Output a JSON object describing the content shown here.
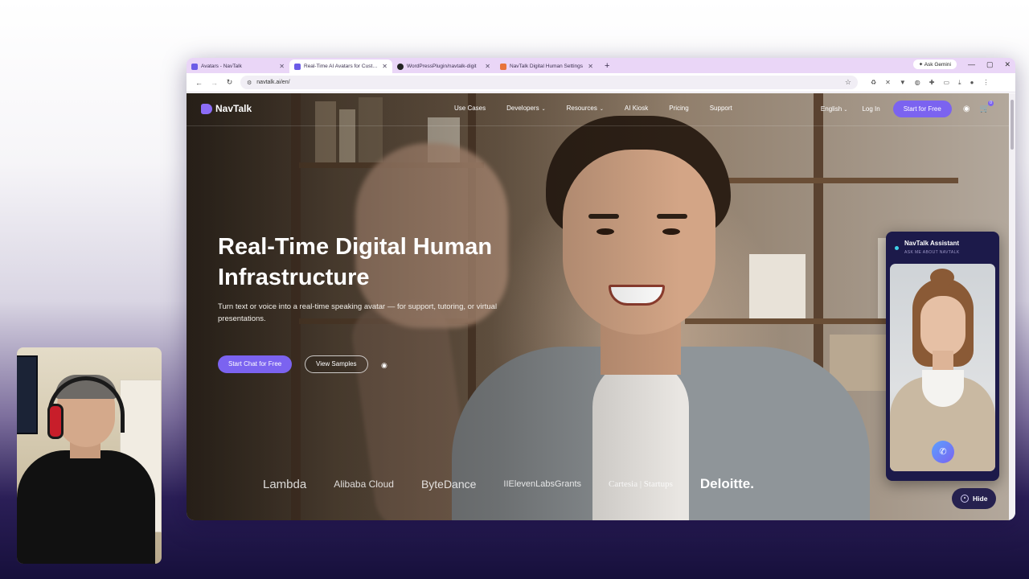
{
  "browser": {
    "tabs": [
      {
        "label": "Avatars - NavTalk",
        "favicon_color": "#6c5ce7",
        "active": false
      },
      {
        "label": "Real-Time AI Avatars for Custom",
        "favicon_color": "#6c5ce7",
        "active": true
      },
      {
        "label": "WordPressPlugin/navtalk-digit",
        "favicon_color": "#222222",
        "active": false
      },
      {
        "label": "NavTalk Digital Human Settings",
        "favicon_color": "#e8743b",
        "active": false
      }
    ],
    "new_tab": "+",
    "gemini_label": "Ask Gemini",
    "url": "navtalk.ai/en/"
  },
  "site": {
    "logo": "NavTalk",
    "menu": [
      {
        "label": "Use Cases",
        "has_caret": false
      },
      {
        "label": "Developers",
        "has_caret": true
      },
      {
        "label": "Resources",
        "has_caret": true
      },
      {
        "label": "AI Kiosk",
        "has_caret": false
      },
      {
        "label": "Pricing",
        "has_caret": false
      },
      {
        "label": "Support",
        "has_caret": false
      }
    ],
    "language": "English",
    "login": "Log In",
    "cta": "Start for Free",
    "cart_count": "0"
  },
  "hero": {
    "title": "Real-Time Digital Human Infrastructure",
    "subtitle": "Turn text or voice into a real-time speaking avatar — for support, tutoring, or virtual presentations.",
    "primary_button": "Start Chat for Free",
    "secondary_button": "View Samples"
  },
  "partners": [
    "Lambda",
    "Alibaba Cloud",
    "ByteDance",
    "IIElevenLabsGrants",
    "Cartesia | Startups",
    "Deloitte."
  ],
  "assistant": {
    "title": "NavTalk Assistant",
    "subtitle": "ASK ME ABOUT NAVTALK",
    "hide_label": "Hide"
  },
  "colors": {
    "accent": "#7b63f0",
    "tabstrip": "#ead6f7",
    "assistant_bg": "#1c1a4a"
  }
}
